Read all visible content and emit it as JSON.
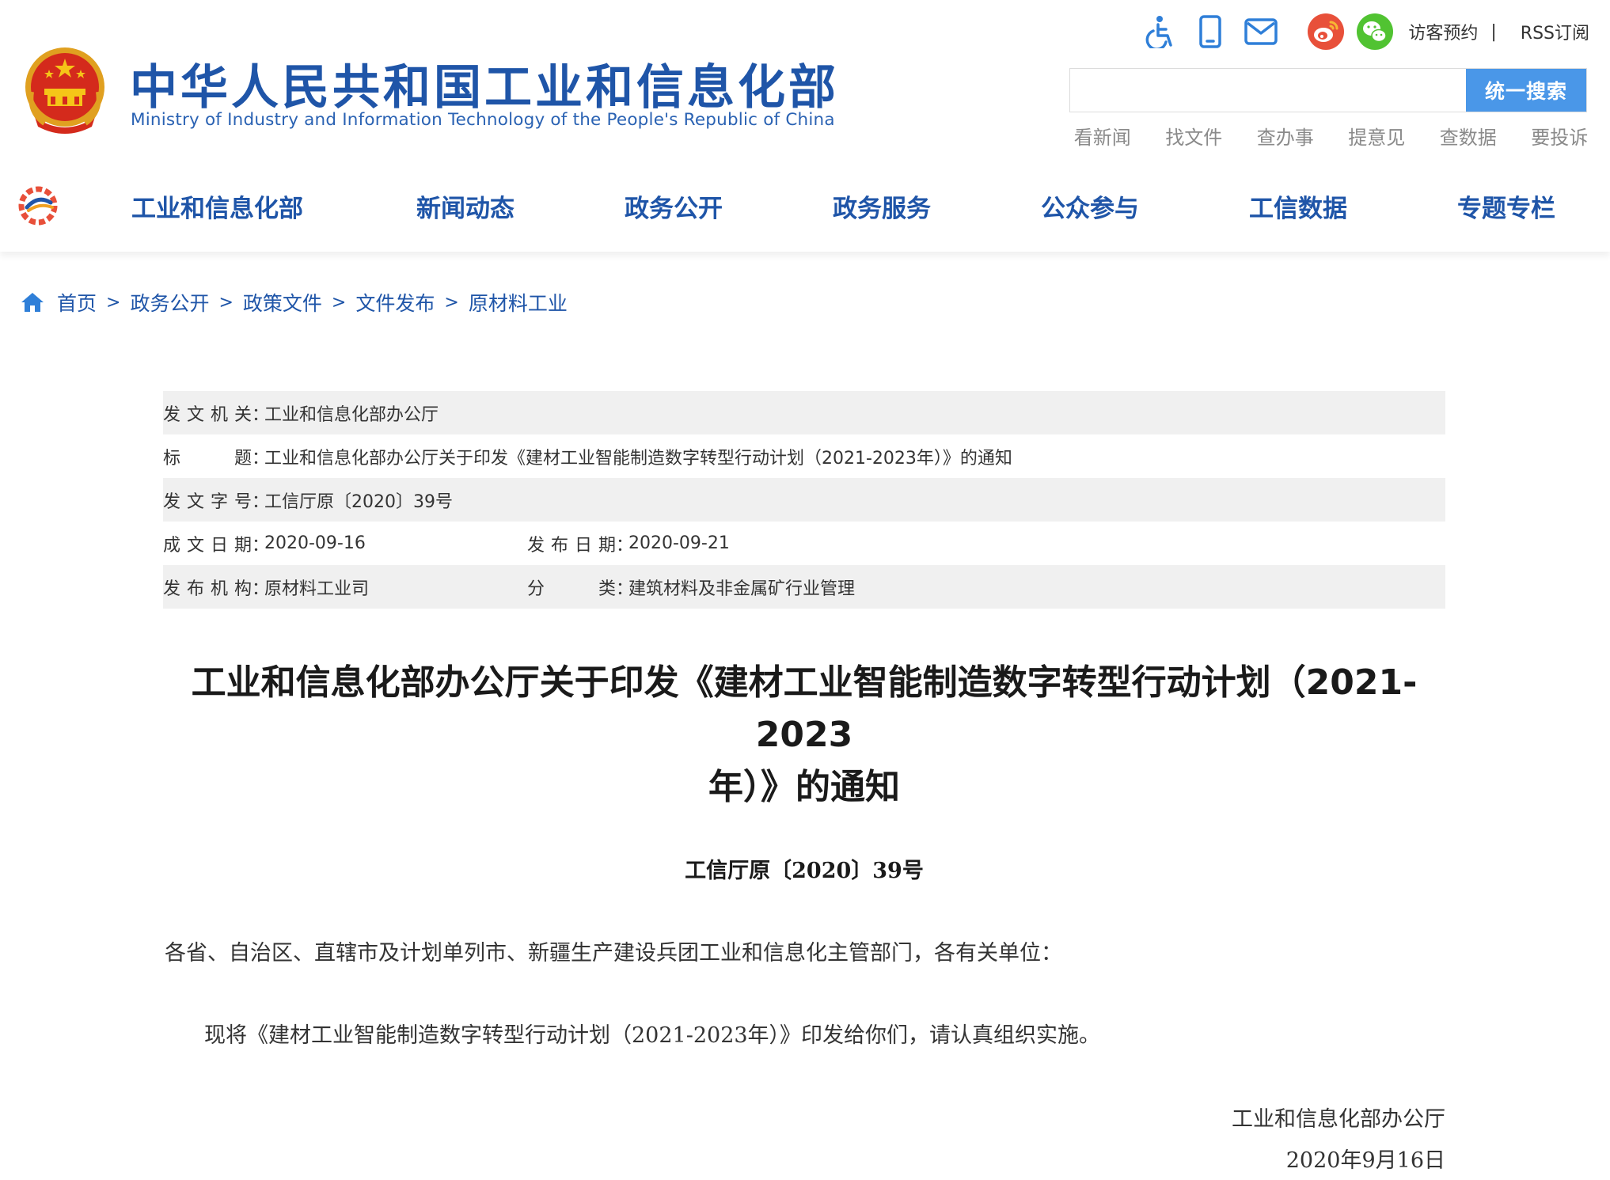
{
  "header": {
    "logo_cn": "中华人民共和国工业和信息化部",
    "logo_en": "Ministry of Industry and Information Technology of the People's Republic of China",
    "tools": {
      "icons": [
        "accessibility-icon",
        "mobile-icon",
        "mail-icon",
        "weibo-icon",
        "wechat-icon"
      ],
      "visit_label": "访客预约",
      "separator": "|",
      "rss_label": "RSS订阅"
    },
    "search": {
      "placeholder": "",
      "button_label": "统一搜索"
    },
    "quick_links": [
      "看新闻",
      "找文件",
      "查办事",
      "提意见",
      "查数据",
      "要投诉"
    ]
  },
  "nav": {
    "items": [
      "工业和信息化部",
      "新闻动态",
      "政务公开",
      "政务服务",
      "公众参与",
      "工信数据",
      "专题专栏"
    ]
  },
  "breadcrumb": {
    "items": [
      "首页",
      "政务公开",
      "政策文件",
      "文件发布",
      "原材料工业"
    ],
    "separator": ">"
  },
  "info": {
    "issuer_label": "发文机关",
    "issuer": "工业和信息化部办公厅",
    "title_label": "标　　题",
    "title": "工业和信息化部办公厅关于印发《建材工业智能制造数字转型行动计划（2021-2023年）》的通知",
    "docno_label": "发文字号",
    "docno": "工信厅原〔2020〕39号",
    "created_label": "成文日期",
    "created": "2020-09-16",
    "published_label": "发布日期",
    "published": "2020-09-21",
    "org_label": "发布机构",
    "org": "原材料工业司",
    "category_label": "分　　类",
    "category": "建筑材料及非金属矿行业管理",
    "colon": "："
  },
  "document": {
    "title_line1": "工业和信息化部办公厅关于印发《建材工业智能制造数字转型行动计划（2021-2023",
    "title_line2": "年）》的通知",
    "number": "工信厅原〔2020〕39号",
    "salutation": "各省、自治区、直辖市及计划单列市、新疆生产建设兵团工业和信息化主管部门，各有关单位：",
    "body": "现将《建材工业智能制造数字转型行动计划（2021-2023年）》印发给你们，请认真组织实施。",
    "signer": "工业和信息化部办公厅",
    "date": "2020年9月16日"
  },
  "colors": {
    "brand_blue": "#1f55a8",
    "search_button": "#4a97e8",
    "row_gray": "#f0f0f0",
    "weibo": "#e6162d",
    "wechat": "#51c332"
  }
}
